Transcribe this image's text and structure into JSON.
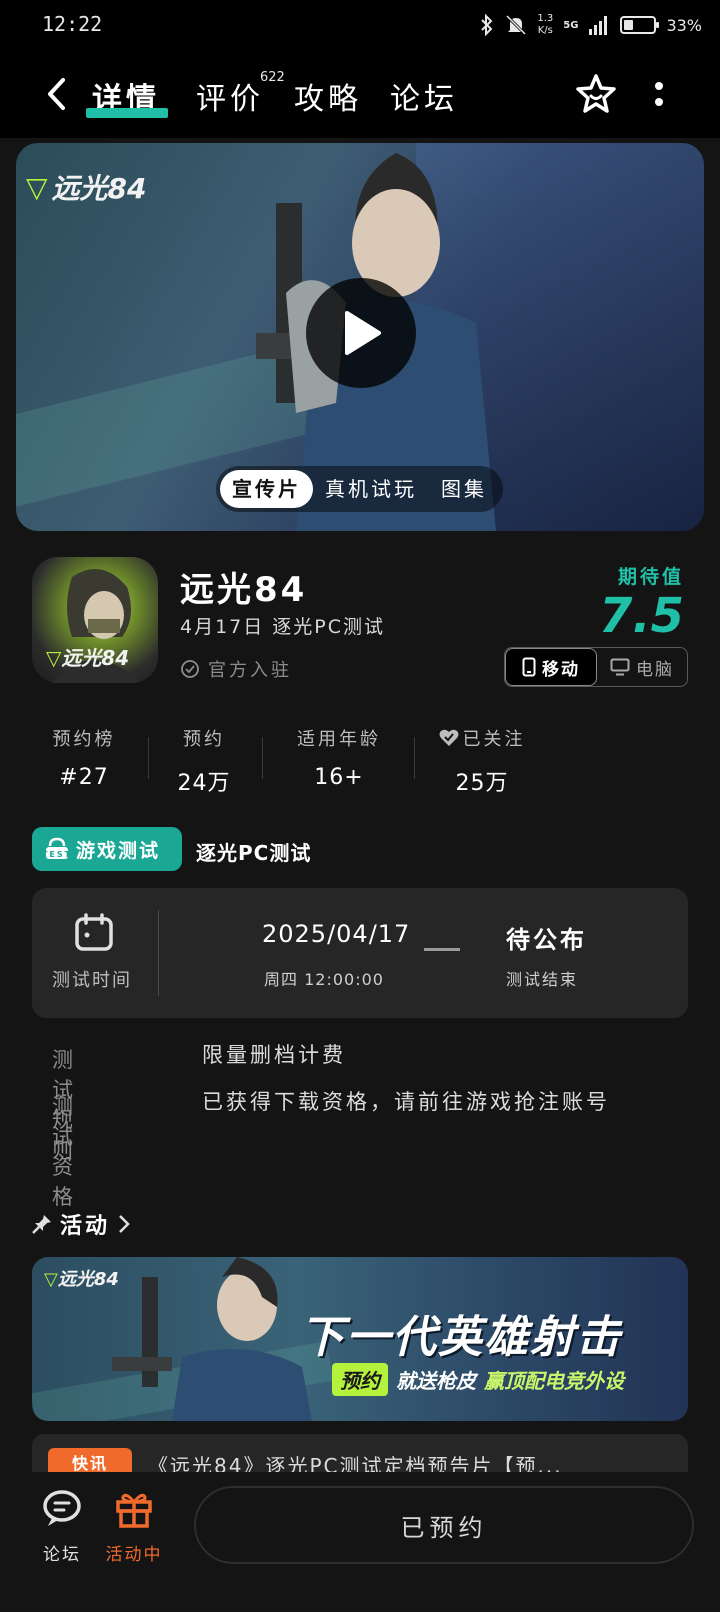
{
  "status_bar": {
    "time": "12:22",
    "speed": "1.3",
    "speed_unit": "K/s",
    "network": "5G",
    "battery": "33%"
  },
  "nav": {
    "tabs": [
      {
        "label": "详情"
      },
      {
        "label": "评价"
      },
      {
        "label": "攻略"
      },
      {
        "label": "论坛"
      }
    ],
    "review_count": "622"
  },
  "hero": {
    "logo_text": "远光84",
    "media_tabs": [
      "宣传片",
      "真机试玩",
      "图集"
    ]
  },
  "app": {
    "title": "远光84",
    "subtitle": "4月17日 逐光PC测试",
    "official": "官方入驻",
    "expect_label": "期待值",
    "expect_value": "7.5",
    "platforms": [
      "移动",
      "电脑"
    ]
  },
  "stats": [
    {
      "label": "预约榜",
      "value": "#27"
    },
    {
      "label": "预约",
      "value": "24万"
    },
    {
      "label": "适用年龄",
      "value": "16+"
    },
    {
      "label": "已关注",
      "value": "25万"
    }
  ],
  "test": {
    "tag": "游戏测试",
    "tag_icon_text": "TEST",
    "name": "逐光PC测试",
    "time_label": "测试时间",
    "start_date": "2025/04/17",
    "start_time": "周四 12:00:00",
    "end_title": "待公布",
    "end_label": "测试结束",
    "rules_key": "测试规则",
    "rules_val": "限量删档计费",
    "qualify_key": "测试资格",
    "qualify_val": "已获得下载资格，请前往游戏抢注账号"
  },
  "activity": {
    "title": "活动",
    "banner_logo": "远光84",
    "banner_headline": "下一代英雄射击",
    "banner_pill": "预约",
    "banner_text1": "就送枪皮",
    "banner_text2": "赢顶配电竞外设",
    "news_tag": "快讯",
    "news_text": "《远光84》逐光PC测试定档预告片【预..."
  },
  "bottom": {
    "forum_label": "论坛",
    "activity_label": "活动中",
    "reserve_label": "已预约"
  },
  "colors": {
    "accent": "#1fc0a7",
    "activity_orange": "#f06a2c",
    "lime": "#b4f23c"
  }
}
